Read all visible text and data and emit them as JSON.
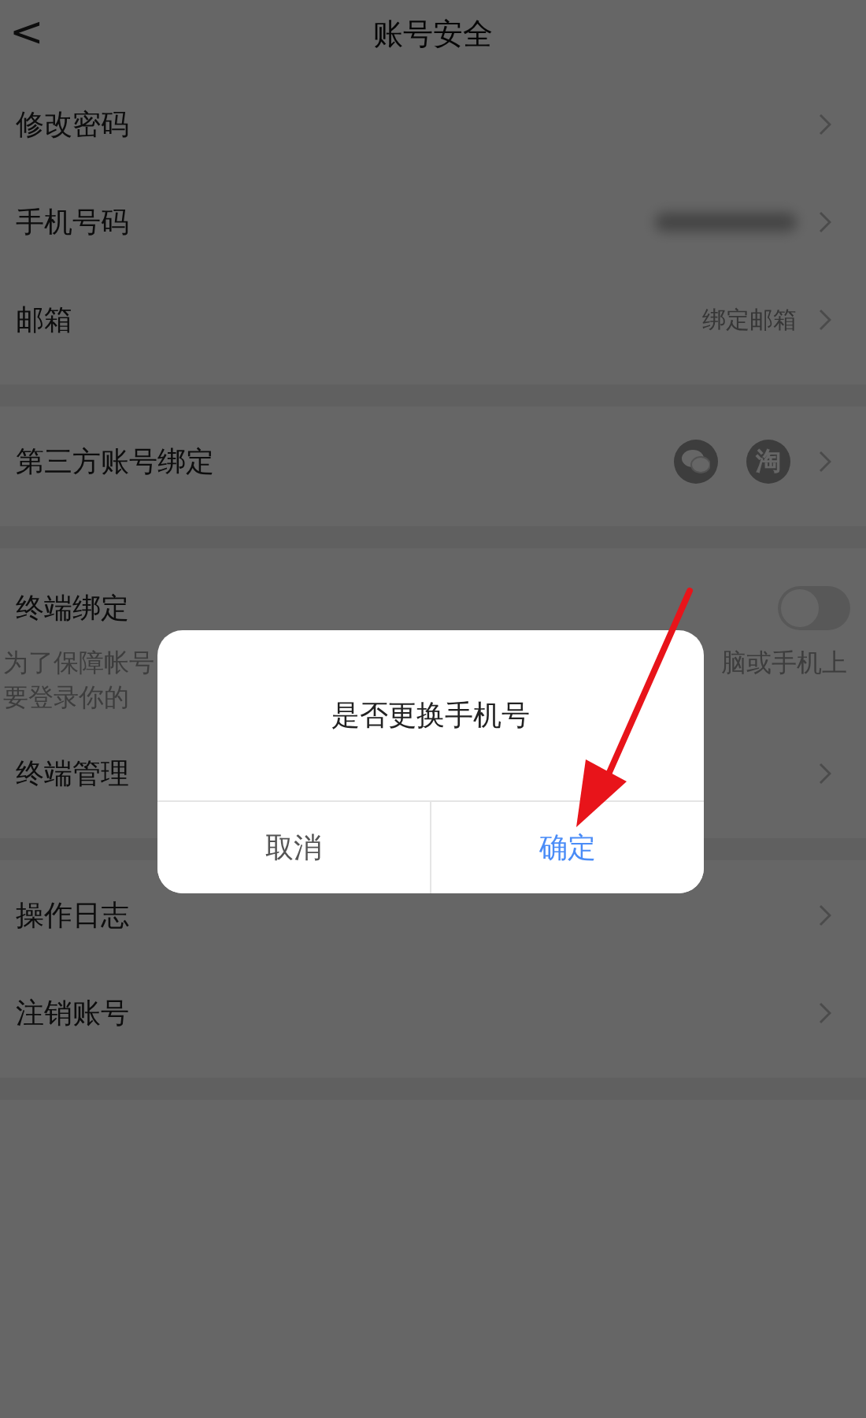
{
  "header": {
    "back": "<",
    "title": "账号安全"
  },
  "sections": [
    {
      "items": [
        {
          "kind": "link",
          "label": "修改密码"
        },
        {
          "kind": "blurred",
          "label": "手机号码"
        },
        {
          "kind": "link",
          "label": "邮箱",
          "value": "绑定邮箱"
        }
      ]
    },
    {
      "items": [
        {
          "kind": "accounts",
          "label": "第三方账号绑定",
          "accounts": [
            {
              "kind": "chat"
            },
            {
              "kind": "text",
              "mark": "淘"
            }
          ]
        }
      ]
    },
    {
      "items": [
        {
          "kind": "toggle",
          "label": "终端绑定",
          "on": false,
          "note_left": [
            "为了保障帐号",
            "要登录你的"
          ],
          "note_right": "脑或手机上"
        },
        {
          "kind": "link",
          "label": "终端管理"
        }
      ]
    },
    {
      "items": [
        {
          "kind": "link",
          "label": "操作日志"
        },
        {
          "kind": "link",
          "label": "注销账号"
        }
      ]
    }
  ],
  "dialog": {
    "message": "是否更换手机号",
    "buttons": [
      {
        "label": "取消",
        "primary": false
      },
      {
        "label": "确定",
        "primary": true
      }
    ]
  },
  "annotation": {
    "kind": "arrow"
  }
}
